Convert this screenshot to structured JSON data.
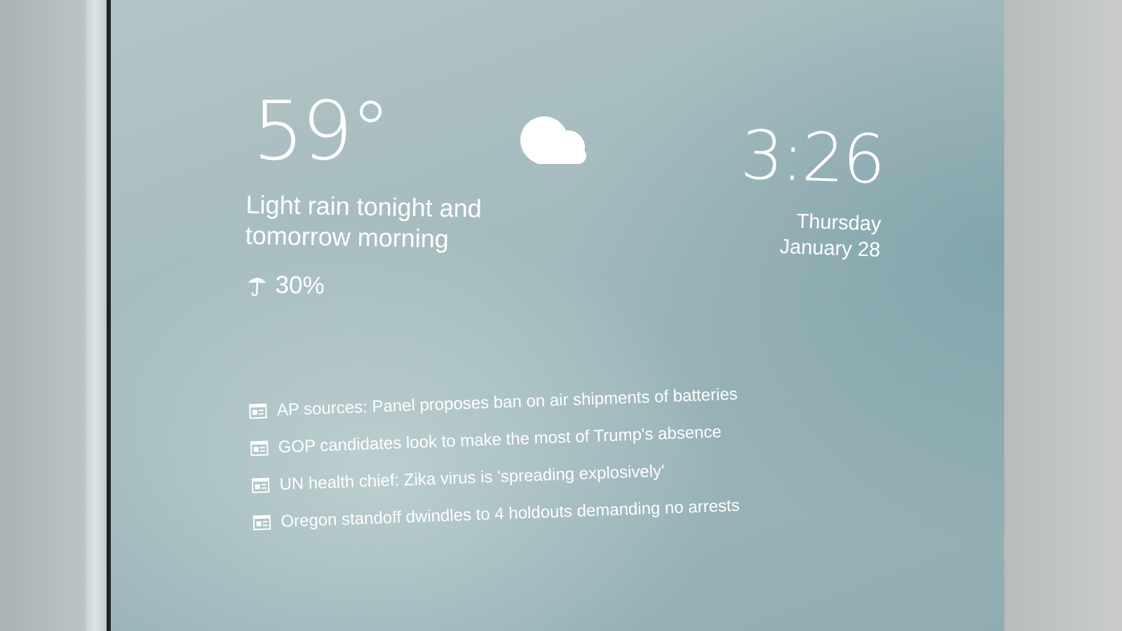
{
  "weather": {
    "temperature": "59°",
    "condition_icon": "cloud-icon",
    "forecast": "Light rain tonight and tomorrow morning",
    "precip_icon": "umbrella-icon",
    "precip_chance": "30%"
  },
  "clock": {
    "time": "3:26",
    "day": "Thursday",
    "date": "January 28"
  },
  "news": {
    "item_icon": "newspaper-icon",
    "items": [
      "AP sources: Panel proposes ban on air shipments of batteries",
      "GOP candidates look to make the most of Trump's absence",
      "UN health chief: Zika virus is 'spreading explosively'",
      "Oregon standoff dwindles to 4 holdouts demanding no arrests"
    ]
  },
  "colors": {
    "text": "#ffffff",
    "mirror_tint": "#9cb6ba"
  }
}
